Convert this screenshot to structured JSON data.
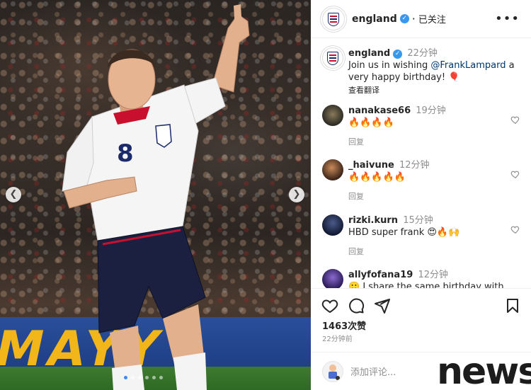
{
  "post": {
    "username": "england",
    "follow_status": "已关注",
    "more_icon": "more-horizontal-icon"
  },
  "photo": {
    "shirt_number": "8",
    "ad_text": "MAYY",
    "carousel_dots": 6,
    "active_dot": 0
  },
  "caption": {
    "username": "england",
    "time": "22分钟",
    "text_prefix": "Join us in wishing ",
    "mention": "@FrankLampard",
    "text_suffix": " a very happy birthday! 🎈",
    "translate": "查看翻译"
  },
  "comments": [
    {
      "username": "nanakase66",
      "time": "19分钟",
      "text": "🔥🔥🔥🔥",
      "reply": "回复"
    },
    {
      "username": "_haivune",
      "time": "12分钟",
      "text": "🔥🔥🔥🔥🔥",
      "reply": "回复"
    },
    {
      "username": "rizki.kurn",
      "time": "15分钟",
      "text": "HBD super frank 😍🔥🙌",
      "reply": "回复"
    },
    {
      "username": "allyfofana19",
      "time": "12分钟",
      "text": "🙂 I share the same birthday with"
    }
  ],
  "actions": {
    "likes": "1463次赞",
    "time_ago": "22分钟前"
  },
  "add_comment": {
    "placeholder": "添加评论..."
  },
  "watermark": "news"
}
